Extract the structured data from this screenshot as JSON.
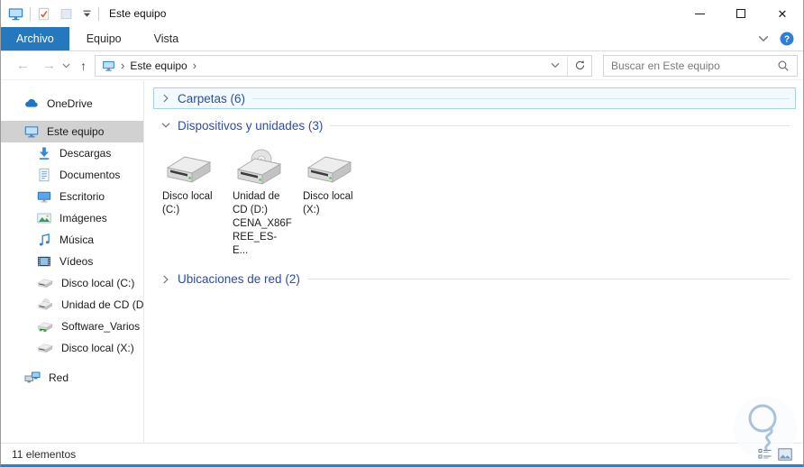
{
  "window": {
    "title": "Este equipo",
    "app_icon": "this-pc-icon"
  },
  "titlebar": {
    "qat": [
      {
        "name": "properties",
        "icon": "properties-icon"
      },
      {
        "name": "new-folder",
        "icon": "folder-icon"
      },
      {
        "name": "customize-quick-access",
        "icon": "qat-caret-icon"
      }
    ]
  },
  "tabs": [
    {
      "label": "Archivo",
      "active": true
    },
    {
      "label": "Equipo",
      "active": false
    },
    {
      "label": "Vista",
      "active": false
    }
  ],
  "ribbon": {
    "collapse_icon": "chevron-down-icon",
    "help_icon": "help-icon"
  },
  "navbar": {
    "back_icon": "arrow-left-icon",
    "forward_icon": "arrow-right-icon",
    "recent_icon": "chevron-down-icon",
    "up_icon": "arrow-up-icon",
    "breadcrumb": {
      "root_icon": "this-pc-icon",
      "separator": "›",
      "segment": "Este equipo"
    },
    "address_dropdown_icon": "chevron-down-icon",
    "refresh_icon": "refresh-icon",
    "search": {
      "placeholder": "Buscar en Este equipo",
      "icon": "search-icon"
    }
  },
  "sidebar": {
    "items": [
      {
        "label": "OneDrive",
        "icon": "onedrive-icon",
        "level": 1,
        "selected": false
      },
      {
        "label": "Este equipo",
        "icon": "this-pc-icon",
        "level": 1,
        "selected": true
      },
      {
        "label": "Descargas",
        "icon": "downloads-icon",
        "level": 2,
        "selected": false
      },
      {
        "label": "Documentos",
        "icon": "documents-icon",
        "level": 2,
        "selected": false
      },
      {
        "label": "Escritorio",
        "icon": "desktop-icon",
        "level": 2,
        "selected": false
      },
      {
        "label": "Imágenes",
        "icon": "pictures-icon",
        "level": 2,
        "selected": false
      },
      {
        "label": "Música",
        "icon": "music-icon",
        "level": 2,
        "selected": false
      },
      {
        "label": "Vídeos",
        "icon": "videos-icon",
        "level": 2,
        "selected": false
      },
      {
        "label": "Disco local (C:)",
        "icon": "hdd-icon",
        "level": 2,
        "selected": false
      },
      {
        "label": "Unidad de CD (D:) C",
        "icon": "cd-icon",
        "level": 2,
        "selected": false
      },
      {
        "label": "Software_Varios (\\\\",
        "icon": "network-drive-icon",
        "level": 2,
        "selected": false
      },
      {
        "label": "Disco local (X:)",
        "icon": "hdd-icon",
        "level": 2,
        "selected": false
      },
      {
        "label": "Red",
        "icon": "network-icon",
        "level": 1,
        "selected": false
      }
    ]
  },
  "content": {
    "groups": [
      {
        "label": "Carpetas (6)",
        "expanded": false,
        "focused": true,
        "chevron": "chevron-right-icon"
      },
      {
        "label": "Dispositivos y unidades (3)",
        "expanded": true,
        "focused": false,
        "chevron": "chevron-down-icon"
      },
      {
        "label": "Ubicaciones de red (2)",
        "expanded": false,
        "focused": false,
        "chevron": "chevron-right-icon"
      }
    ],
    "drives": [
      {
        "label": "Disco local (C:)",
        "icon": "hdd-large-icon"
      },
      {
        "label": "Unidad de CD (D:) CENA_X86FREE_ES-E...",
        "icon": "cd-large-icon"
      },
      {
        "label": "Disco local (X:)",
        "icon": "hdd-large-icon"
      }
    ]
  },
  "statusbar": {
    "text": "11 elementos",
    "views": [
      {
        "name": "details-view",
        "icon": "list-view-icon"
      },
      {
        "name": "thumbnails-view",
        "icon": "thumb-view-icon"
      }
    ]
  },
  "watermark": {
    "icon": "bulb-icon"
  },
  "colors": {
    "active_tab_blue": "#2578be",
    "group_header_blue": "#2b4da8",
    "selection_grey": "#d1d1d1",
    "focus_border_blue": "#a6d1ef",
    "window_border_bottom": "#2f7fc1",
    "help_icon_blue": "#2e7fd6"
  }
}
